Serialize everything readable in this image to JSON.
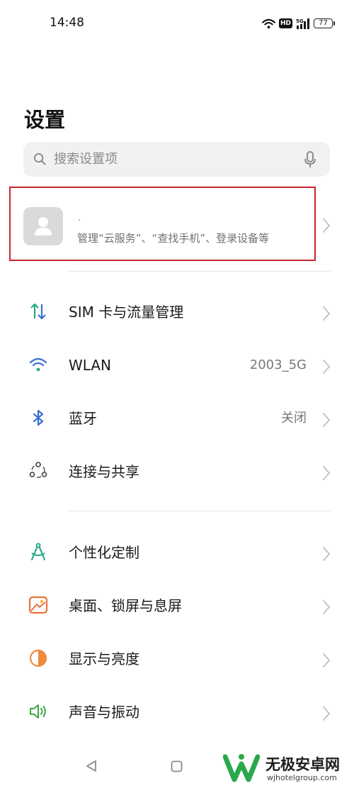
{
  "status_bar": {
    "time": "14:48",
    "network_badge": "HD",
    "signal_label": "5G",
    "battery": "77",
    "icons": [
      "wifi-icon",
      "hd-icon",
      "signal-5g-icon",
      "battery-icon"
    ]
  },
  "page": {
    "title": "设置"
  },
  "search": {
    "placeholder": "搜索设置项",
    "icons": [
      "search-icon",
      "mic-icon"
    ]
  },
  "account": {
    "name": ".",
    "subtitle": "管理“云服务”、“查找手机”、登录设备等",
    "highlight_color": "#c8272d"
  },
  "groups": [
    {
      "items": [
        {
          "label": "SIM 卡与流量管理",
          "value": "",
          "icon": "sim-data-icon",
          "color": "#2aa88a"
        },
        {
          "label": "WLAN",
          "value": "2003_5G",
          "icon": "wifi-icon",
          "color": "#3b6fd0"
        },
        {
          "label": "蓝牙",
          "value": "关闭",
          "icon": "bluetooth-icon",
          "color": "#3b6fd0"
        },
        {
          "label": "连接与共享",
          "value": "",
          "icon": "share-icon",
          "color": "#555555"
        }
      ]
    },
    {
      "items": [
        {
          "label": "个性化定制",
          "value": "",
          "icon": "personalize-icon",
          "color": "#2aa88a"
        },
        {
          "label": "桌面、锁屏与息屏",
          "value": "",
          "icon": "wallpaper-icon",
          "color": "#e8743b"
        },
        {
          "label": "显示与亮度",
          "value": "",
          "icon": "brightness-icon",
          "color": "#f08a3e"
        },
        {
          "label": "声音与振动",
          "value": "",
          "icon": "sound-icon",
          "color": "#3aa845"
        }
      ]
    }
  ],
  "nav_bar": {
    "icons": [
      "back-icon",
      "home-icon"
    ]
  },
  "watermark": {
    "text": "无极安卓网",
    "url": "wjhotelgroup.com",
    "brand_color": "#2aa84a"
  }
}
